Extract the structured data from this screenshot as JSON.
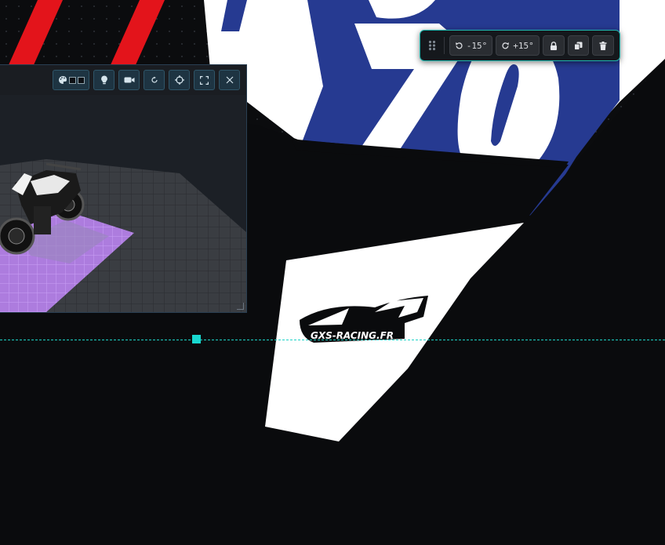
{
  "canvas": {
    "decal_text": "GXS-RACING.FR",
    "colors": {
      "navy": "#263a91",
      "red": "#e3141b",
      "white": "#ffffff",
      "background": "#0b0c0e",
      "accent": "#1dd3c7"
    }
  },
  "toolbar": {
    "drag_handle_icon": "grip-dots-icon",
    "rotate_left_label": "-15°",
    "rotate_right_label": "+15°",
    "buttons": [
      {
        "name": "rotate-left",
        "icon": "rotate-ccw-icon"
      },
      {
        "name": "rotate-right",
        "icon": "rotate-cw-icon"
      },
      {
        "name": "lock",
        "icon": "lock-icon"
      },
      {
        "name": "duplicate",
        "icon": "copy-icon"
      },
      {
        "name": "delete",
        "icon": "trash-icon"
      }
    ]
  },
  "preview": {
    "header_buttons": [
      {
        "name": "palette",
        "icon": "palette-icon"
      },
      {
        "name": "lighting",
        "icon": "lightbulb-icon"
      },
      {
        "name": "camera",
        "icon": "video-camera-icon"
      },
      {
        "name": "reset",
        "icon": "refresh-icon"
      },
      {
        "name": "center",
        "icon": "crosshair-icon"
      },
      {
        "name": "fullscreen",
        "icon": "expand-icon"
      },
      {
        "name": "close",
        "icon": "close-icon"
      }
    ]
  }
}
